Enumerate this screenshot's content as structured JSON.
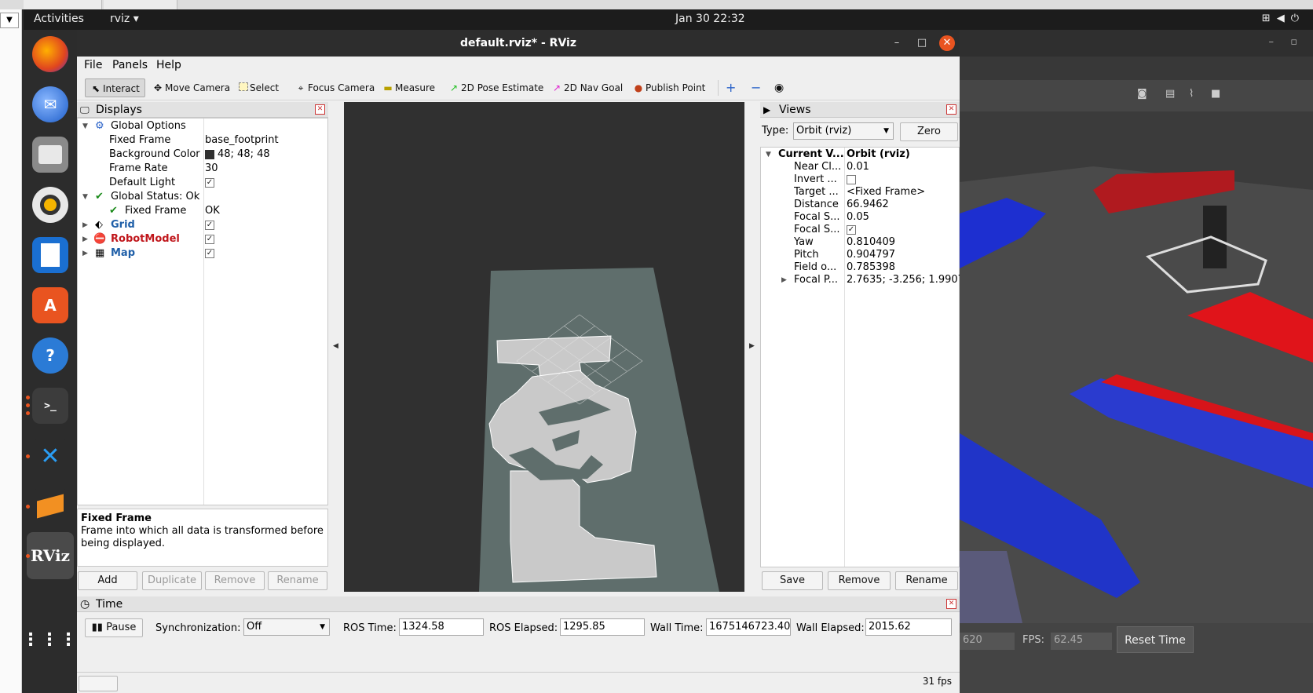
{
  "topbar": {
    "activities": "Activities",
    "app": "rviz",
    "clock": "Jan 30  22:32"
  },
  "window": {
    "title": "default.rviz* - RViz"
  },
  "menu": [
    "File",
    "Panels",
    "Help"
  ],
  "toolbar": {
    "interact": "Interact",
    "move_camera": "Move Camera",
    "select": "Select",
    "focus_camera": "Focus Camera",
    "measure": "Measure",
    "pose_estimate": "2D Pose Estimate",
    "nav_goal": "2D Nav Goal",
    "publish_point": "Publish Point"
  },
  "displays": {
    "title": "Displays",
    "global_options": "Global Options",
    "fixed_frame_label": "Fixed Frame",
    "fixed_frame_value": "base_footprint",
    "bg_color_label": "Background Color",
    "bg_color_value": "48; 48; 48",
    "frame_rate_label": "Frame Rate",
    "frame_rate_value": "30",
    "default_light_label": "Default Light",
    "global_status": "Global Status: Ok",
    "status_fixed_frame": "Fixed Frame",
    "status_fixed_frame_value": "OK",
    "grid": "Grid",
    "robot_model": "RobotModel",
    "map": "Map",
    "desc_title": "Fixed Frame",
    "desc_text": "Frame into which all data is transformed before being displayed.",
    "add": "Add",
    "duplicate": "Duplicate",
    "remove": "Remove",
    "rename": "Rename"
  },
  "views": {
    "title": "Views",
    "type_label": "Type:",
    "type_value": "Orbit (rviz)",
    "zero": "Zero",
    "current_view": "Current V...",
    "current_view_value": "Orbit (rviz)",
    "props": [
      {
        "k": "Near Cl...",
        "v": "0.01"
      },
      {
        "k": "Invert ...",
        "v": ""
      },
      {
        "k": "Target ...",
        "v": "<Fixed Frame>"
      },
      {
        "k": "Distance",
        "v": "66.9462"
      },
      {
        "k": "Focal S...",
        "v": "0.05"
      },
      {
        "k": "Focal S...",
        "v": ""
      },
      {
        "k": "Yaw",
        "v": "0.810409"
      },
      {
        "k": "Pitch",
        "v": "0.904797"
      },
      {
        "k": "Field o...",
        "v": "0.785398"
      },
      {
        "k": "Focal P...",
        "v": "2.7635; -3.256; 1.9907"
      }
    ],
    "save": "Save",
    "remove": "Remove",
    "rename": "Rename"
  },
  "time": {
    "title": "Time",
    "pause": "Pause",
    "sync_label": "Synchronization:",
    "sync_value": "Off",
    "ros_time_label": "ROS Time:",
    "ros_time": "1324.58",
    "ros_elapsed_label": "ROS Elapsed:",
    "ros_elapsed": "1295.85",
    "wall_time_label": "Wall Time:",
    "wall_time": "1675146723.40",
    "wall_elapsed_label": "Wall Elapsed:",
    "wall_elapsed": "2015.62",
    "status_fps": "31 fps"
  },
  "gazebo": {
    "fps_label": "FPS:",
    "fps": "62.45",
    "left_value": "620",
    "reset": "Reset Time"
  },
  "colors": {
    "accent": "#e95420",
    "grid_blue": "#1f5fa8",
    "robot_red": "#c0161b"
  }
}
